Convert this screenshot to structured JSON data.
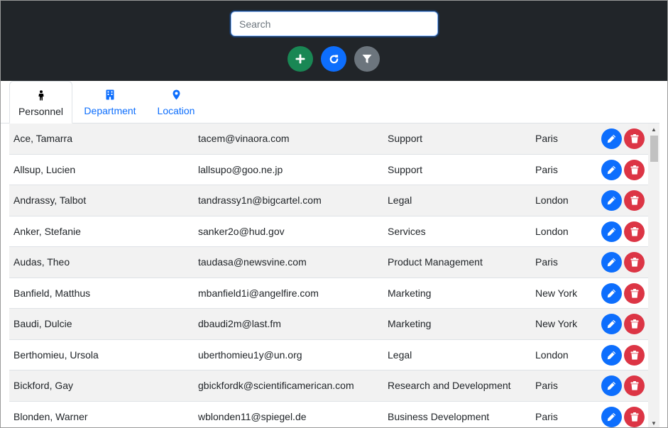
{
  "header": {
    "search_placeholder": "Search",
    "buttons": {
      "add": {
        "icon": "plus-icon",
        "color": "#198754"
      },
      "refresh": {
        "icon": "refresh-icon",
        "color": "#0d6efd"
      },
      "filter": {
        "icon": "filter-icon",
        "color": "#6c757d"
      }
    }
  },
  "tabs": [
    {
      "label": "Personnel",
      "icon": "person-icon",
      "active": true
    },
    {
      "label": "Department",
      "icon": "building-icon",
      "active": false
    },
    {
      "label": "Location",
      "icon": "map-pin-icon",
      "active": false
    }
  ],
  "personnel": [
    {
      "name": "Ace, Tamarra",
      "email": "tacem@vinaora.com",
      "department": "Support",
      "location": "Paris"
    },
    {
      "name": "Allsup, Lucien",
      "email": "lallsupo@goo.ne.jp",
      "department": "Support",
      "location": "Paris"
    },
    {
      "name": "Andrassy, Talbot",
      "email": "tandrassy1n@bigcartel.com",
      "department": "Legal",
      "location": "London"
    },
    {
      "name": "Anker, Stefanie",
      "email": "sanker2o@hud.gov",
      "department": "Services",
      "location": "London"
    },
    {
      "name": "Audas, Theo",
      "email": "taudasa@newsvine.com",
      "department": "Product Management",
      "location": "Paris"
    },
    {
      "name": "Banfield, Matthus",
      "email": "mbanfield1i@angelfire.com",
      "department": "Marketing",
      "location": "New York"
    },
    {
      "name": "Baudi, Dulcie",
      "email": "dbaudi2m@last.fm",
      "department": "Marketing",
      "location": "New York"
    },
    {
      "name": "Berthomieu, Ursola",
      "email": "uberthomieu1y@un.org",
      "department": "Legal",
      "location": "London"
    },
    {
      "name": "Bickford, Gay",
      "email": "gbickfordk@scientificamerican.com",
      "department": "Research and Development",
      "location": "Paris"
    },
    {
      "name": "Blonden, Warner",
      "email": "wblonden11@spiegel.de",
      "department": "Business Development",
      "location": "Paris"
    }
  ],
  "row_actions": {
    "edit": {
      "icon": "pencil-icon",
      "color": "#0d6efd"
    },
    "delete": {
      "icon": "trash-icon",
      "color": "#dc3545"
    }
  }
}
